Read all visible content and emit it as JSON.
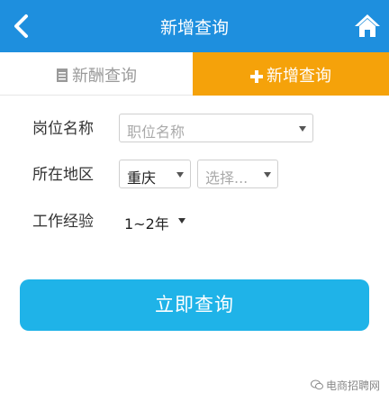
{
  "header": {
    "title": "新增查询"
  },
  "tabs": {
    "salary_query": "新酬查询",
    "add_query": "新增查询"
  },
  "form": {
    "position": {
      "label": "岗位名称",
      "placeholder": "职位名称"
    },
    "region": {
      "label": "所在地区",
      "city": "重庆",
      "district": "选择..."
    },
    "experience": {
      "label": "工作经验",
      "value": "1~2年"
    }
  },
  "submit_label": "立即查询",
  "watermark": "电商招聘网",
  "colors": {
    "header": "#1e8fde",
    "active_tab": "#f5a20a",
    "button": "#1fb3e8"
  }
}
